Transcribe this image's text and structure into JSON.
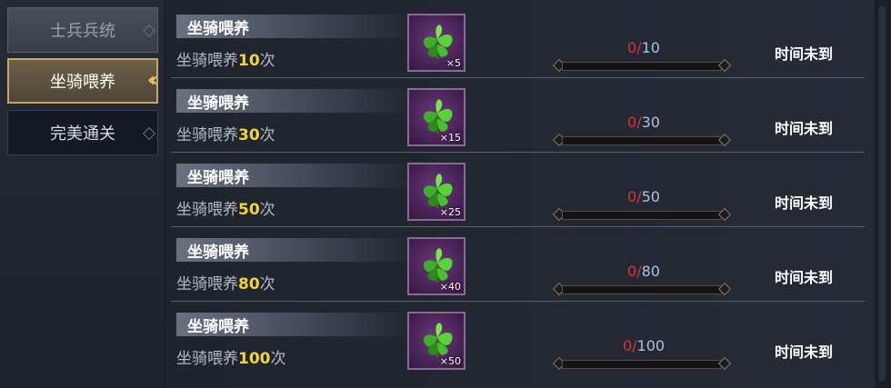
{
  "sidebar": {
    "tabs": [
      {
        "label": "士兵兵统",
        "selected": false
      },
      {
        "label": "坐骑喂养",
        "selected": true
      },
      {
        "label": "完美通关",
        "selected": false
      }
    ]
  },
  "tasks": [
    {
      "title": "坐骑喂养",
      "desc_prefix": "坐骑喂养",
      "desc_num": "10",
      "desc_suffix": "次",
      "reward_qty": "×5",
      "progress_current": "0",
      "progress_sep": "/",
      "progress_total": "10",
      "progress_fraction": 0,
      "status": "时间未到"
    },
    {
      "title": "坐骑喂养",
      "desc_prefix": "坐骑喂养",
      "desc_num": "30",
      "desc_suffix": "次",
      "reward_qty": "×15",
      "progress_current": "0",
      "progress_sep": "/",
      "progress_total": "30",
      "progress_fraction": 0,
      "status": "时间未到"
    },
    {
      "title": "坐骑喂养",
      "desc_prefix": "坐骑喂养",
      "desc_num": "50",
      "desc_suffix": "次",
      "reward_qty": "×25",
      "progress_current": "0",
      "progress_sep": "/",
      "progress_total": "50",
      "progress_fraction": 0,
      "status": "时间未到"
    },
    {
      "title": "坐骑喂养",
      "desc_prefix": "坐骑喂养",
      "desc_num": "80",
      "desc_suffix": "次",
      "reward_qty": "×40",
      "progress_current": "0",
      "progress_sep": "/",
      "progress_total": "80",
      "progress_fraction": 0,
      "status": "时间未到"
    },
    {
      "title": "坐骑喂养",
      "desc_prefix": "坐骑喂养",
      "desc_num": "100",
      "desc_suffix": "次",
      "reward_qty": "×50",
      "progress_current": "0",
      "progress_sep": "/",
      "progress_total": "100",
      "progress_fraction": 0,
      "status": "时间未到"
    }
  ],
  "reward_icon": "green-herb-icon",
  "colors": {
    "accent": "#c6a868",
    "highlight_number": "#f2d43c",
    "progress_current": "#d8323a",
    "progress_total": "#aac4e4"
  }
}
